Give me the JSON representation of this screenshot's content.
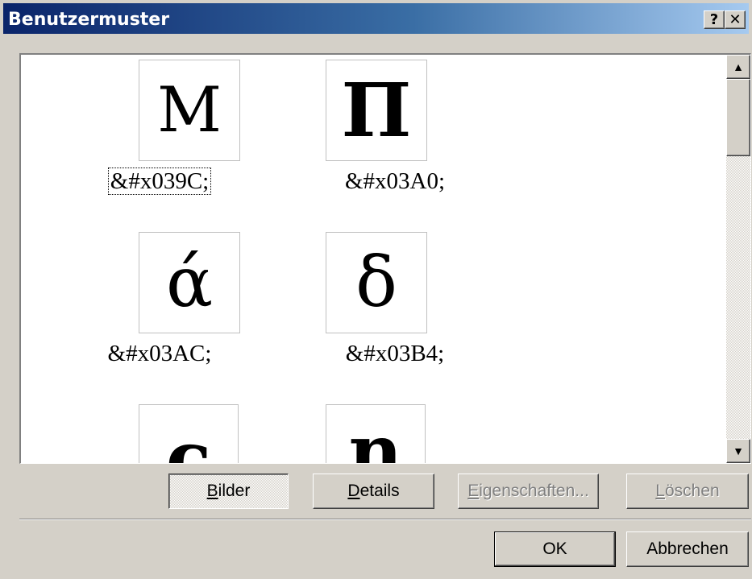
{
  "window": {
    "title": "Benutzermuster",
    "help_label": "?",
    "close_label": "✕"
  },
  "list": {
    "items": [
      {
        "glyph": "Μ",
        "label": "&#x039C;"
      },
      {
        "glyph": "Π",
        "label": "&#x03A0;"
      },
      {
        "glyph": "ά",
        "label": "&#x03AC;"
      },
      {
        "glyph": "δ",
        "label": "&#x03B4;"
      },
      {
        "glyph": "ς",
        "label": ""
      },
      {
        "glyph": "η",
        "label": ""
      }
    ]
  },
  "scrollbar": {
    "up_icon": "▲",
    "down_icon": "▼"
  },
  "buttons": {
    "bilder": {
      "first": "B",
      "rest": "ilder"
    },
    "details": {
      "first": "D",
      "rest": "etails"
    },
    "eigenschaften": {
      "first": "E",
      "rest": "igenschaften..."
    },
    "loeschen": {
      "first": "L",
      "rest": "öschen"
    },
    "ok": "OK",
    "abbrechen": "Abbrechen"
  }
}
